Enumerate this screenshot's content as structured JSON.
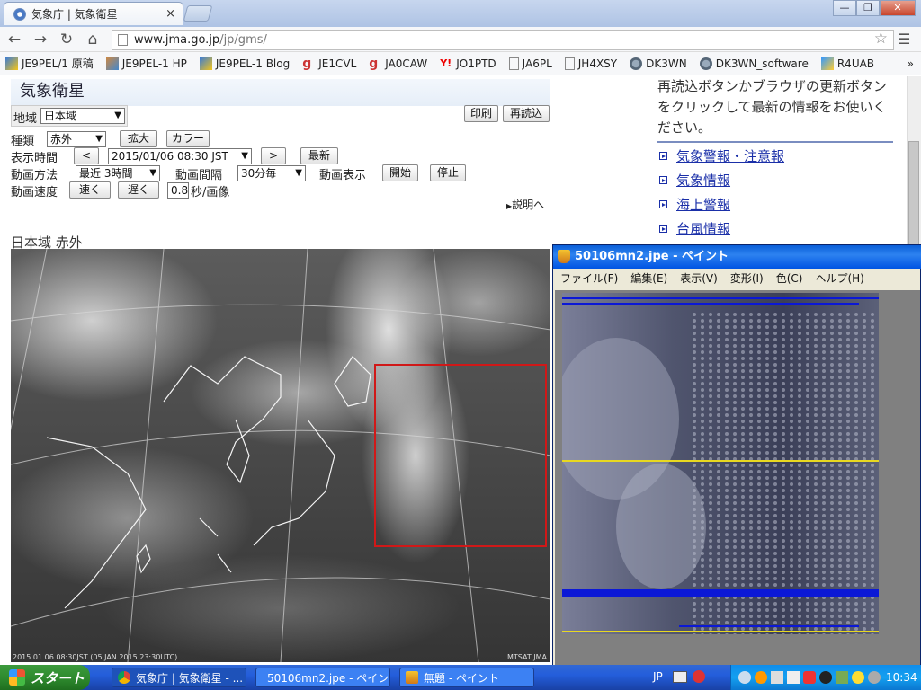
{
  "browser": {
    "tab_title": "気象庁 | 気象衛星",
    "tab_close": "×",
    "window_buttons": [
      "—",
      "❐",
      "✕"
    ],
    "url_host": "www.jma.go.jp",
    "url_path": "/jp/gms/",
    "bookmarks": [
      "JE9PEL/1 原稿",
      "JE9PEL-1 HP",
      "JE9PEL-1 Blog",
      "JE1CVL",
      "JA0CAW",
      "JO1PTD",
      "JA6PL",
      "JH4XSY",
      "DK3WN",
      "DK3WN_software",
      "R4UAB"
    ],
    "bookmarks_more": "»"
  },
  "page": {
    "title": "気象衛星",
    "region_label": "地域",
    "region_value": "日本域",
    "print_button": "印刷",
    "reload_button": "再読込",
    "type_label": "種類",
    "type_value": "赤外",
    "zoom_button": "拡大",
    "color_button": "カラー",
    "time_label": "表示時間",
    "prev_button": "<",
    "time_value": "2015/01/06 08:30 JST",
    "next_button": ">",
    "latest_button": "最新",
    "anim_method_label": "動画方法",
    "anim_method_value": "最近 3時間",
    "anim_interval_label": "動画間隔",
    "anim_interval_value": "30分毎",
    "anim_display_label": "動画表示",
    "start_button": "開始",
    "stop_button": "停止",
    "anim_speed_label": "動画速度",
    "faster_button": "速く",
    "slower_button": "遅く",
    "speed_value": "0.8",
    "speed_unit": "秒/画像",
    "explain_link": "説明へ",
    "image_caption": "日本域  赤外",
    "sat_footer_left": "2015.01.06 08:30JST (05 JAN 2015 23:30UTC)",
    "sat_footer_right": "MTSAT JMA"
  },
  "right": {
    "notice": "再読込ボタンかブラウザの更新ボタンをクリックして最新の情報をお使いください。",
    "links": [
      "気象警報・注意報",
      "気象情報",
      "海上警報",
      "台風情報"
    ]
  },
  "paint": {
    "title": "50106mn2.jpe - ペイント",
    "menu": [
      "ファイル(F)",
      "編集(E)",
      "表示(V)",
      "変形(I)",
      "色(C)",
      "ヘルプ(H)"
    ]
  },
  "taskbar": {
    "start": "スタート",
    "tasks": [
      "気象庁 | 気象衛星 - ...",
      "50106mn2.jpe - ペイン...",
      "無題 - ペイント"
    ],
    "lang": "JP",
    "clock": "10:34"
  },
  "colors": {
    "accent_link": "#1a2fa8",
    "red_box": "#d01818",
    "xp_blue": "#245edb",
    "start_green": "#2f8b2f"
  }
}
